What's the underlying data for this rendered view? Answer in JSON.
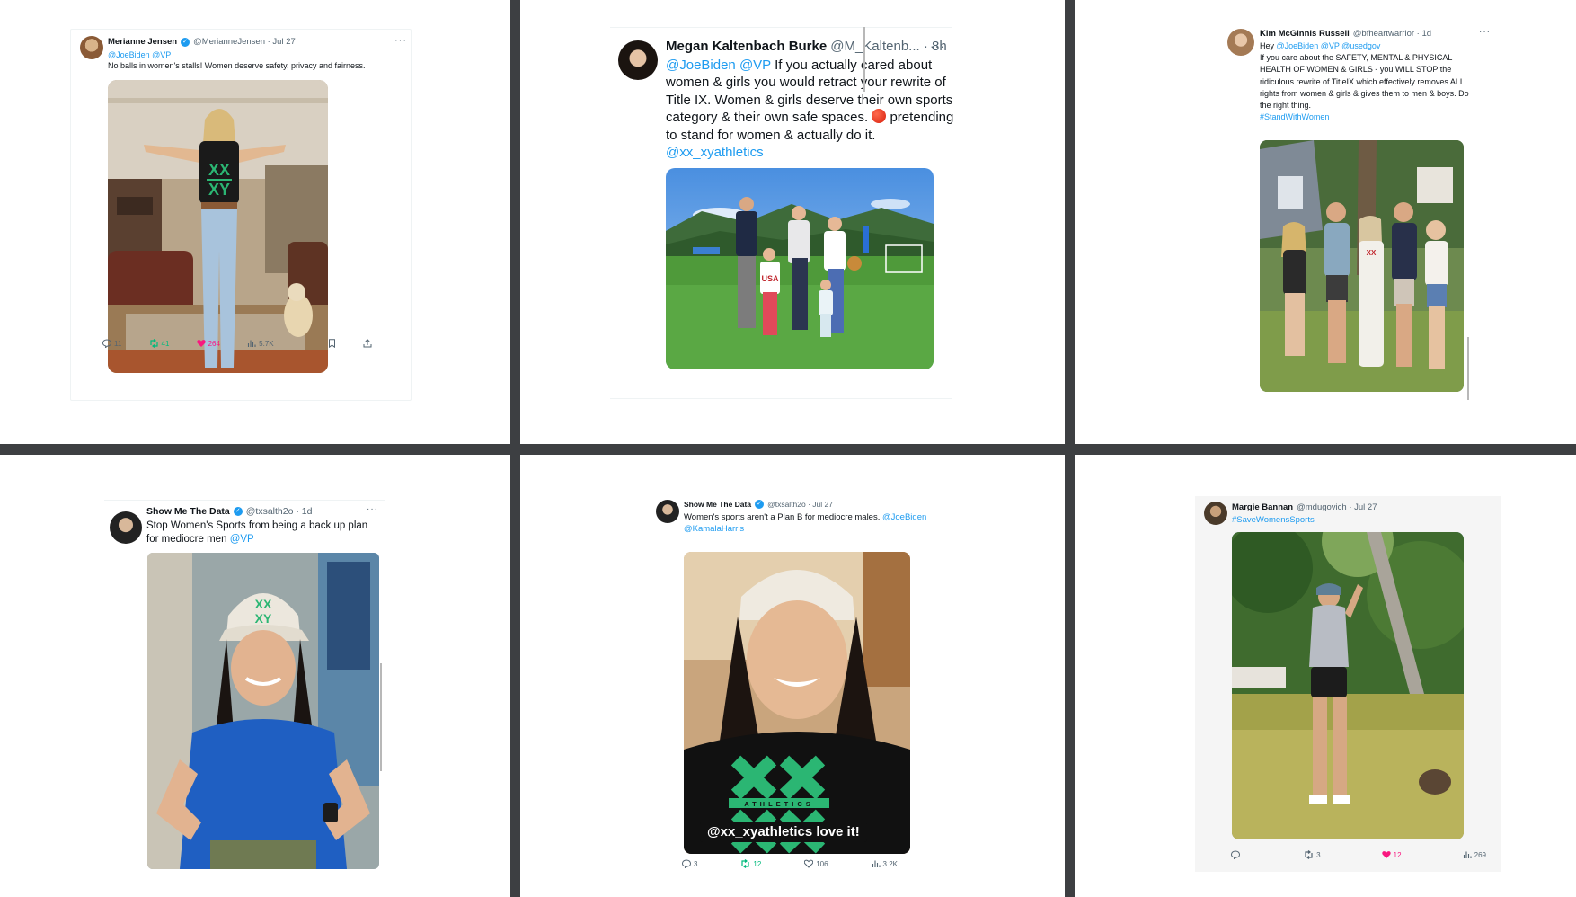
{
  "tweets": [
    {
      "name": "Merianne Jensen",
      "handle": "@MerianneJensen · Jul 27",
      "mentions": "@JoeBiden @VP",
      "text": "No balls in women's stalls!  Women deserve safety, privacy and fairness.",
      "replies": "11",
      "retweets": "41",
      "likes": "264",
      "views": "5.7K"
    },
    {
      "name": "Megan Kaltenbach Burke",
      "handle": "@M_Kaltenb... · 8h",
      "mentions": "@JoeBiden @VP",
      "text": "If you actually cared about women & girls you would retract your rewrite of Title IX. Women & girls deserve their own sports category & their own safe spaces.",
      "text_after_emoji": "pretending to stand for women & actually do it.",
      "trailing_link": "@xx_xyathletics"
    },
    {
      "name": "Kim McGinnis Russell",
      "handle": "@bfheartwarrior · 1d",
      "greeting": "Hey",
      "mentions": "@JoeBiden @VP @usedgov",
      "text": "If you care about the SAFETY, MENTAL & PHYSICAL HEALTH OF WOMEN & GIRLS - you WILL STOP the ridiculous rewrite of TitleIX which effectively removes ALL rights from women & girls & gives them to men & boys.  Do the right thing.",
      "hashtag": "#StandWithWomen"
    },
    {
      "name": "Show Me The Data",
      "handle": "@txsalth2o · 1d",
      "text": "Stop Women's Sports from being a back up plan for mediocre men",
      "mention": "@VP"
    },
    {
      "name": "Show Me The Data",
      "handle": "@txsalth2o · Jul 27",
      "text": "Women's sports aren't  a Plan B for mediocre males.",
      "mentions": "@JoeBiden @KamalaHarris",
      "video_caption": "@xx_xyathletics love it!",
      "replies": "3",
      "retweets": "12",
      "likes": "106",
      "views": "3.2K"
    },
    {
      "name": "Margie Bannan",
      "handle": "@mdugovich · Jul 27",
      "hashtag": "#SaveWomensSports",
      "replies": "",
      "retweets": "3",
      "likes": "12",
      "views": "269"
    }
  ],
  "shirt_logo": {
    "top": "XX",
    "bottom": "XY",
    "word": "ATHLETICS"
  },
  "colors": {
    "divider": "#3d3f42",
    "link": "#1d9bf0",
    "verified": "#1d9bf0",
    "retweet": "#00ba7c",
    "like": "#f91880",
    "muted": "#536471",
    "logo_green": "#2bb673"
  }
}
